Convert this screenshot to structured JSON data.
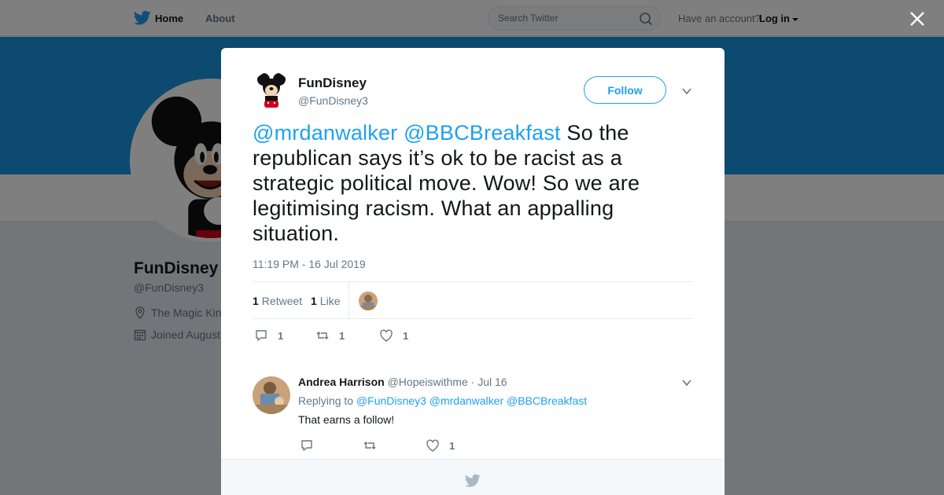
{
  "nav": {
    "home_label": "Home",
    "about_label": "About",
    "search_placeholder": "Search Twitter",
    "have_account": "Have an account?",
    "login_label": "Log in"
  },
  "profile": {
    "name": "FunDisney",
    "handle": "@FunDisney3",
    "location": "The Magic Kin",
    "joined": "Joined August"
  },
  "tweet": {
    "author_name": "FunDisney",
    "author_handle": "@FunDisney3",
    "follow_label": "Follow",
    "mention_1": "@mrdanwalker",
    "mention_2": "@BBCBreakfast",
    "body": "So the republican says it’s ok to be racist as a strategic political move. Wow! So we are legitimising racism. What an appalling situation.",
    "timestamp": "11:19 PM - 16 Jul 2019",
    "retweet_count": "1",
    "retweet_label": "Retweet",
    "like_count": "1",
    "like_label": "Like",
    "actions": {
      "replies": "1",
      "retweets": "1",
      "likes": "1"
    }
  },
  "reply": {
    "name": "Andrea Harrison",
    "handle": "@Hopeiswithme",
    "dot": "·",
    "date": "Jul 16",
    "replying_to_label": "Replying to",
    "mentions": [
      "@FunDisney3",
      "@mrdanwalker",
      "@BBCBreakfast"
    ],
    "text": "That earns a follow!",
    "likes": "1"
  },
  "colors": {
    "twitter_blue": "#1da1f2",
    "banner_blue": "#1b95e0",
    "text_primary": "#14171a",
    "text_secondary": "#657786"
  },
  "icons": [
    "twitter-bird-icon",
    "search-icon",
    "close-icon",
    "chevron-down-icon",
    "reply-icon",
    "retweet-icon",
    "heart-icon",
    "location-pin-icon",
    "calendar-icon"
  ]
}
